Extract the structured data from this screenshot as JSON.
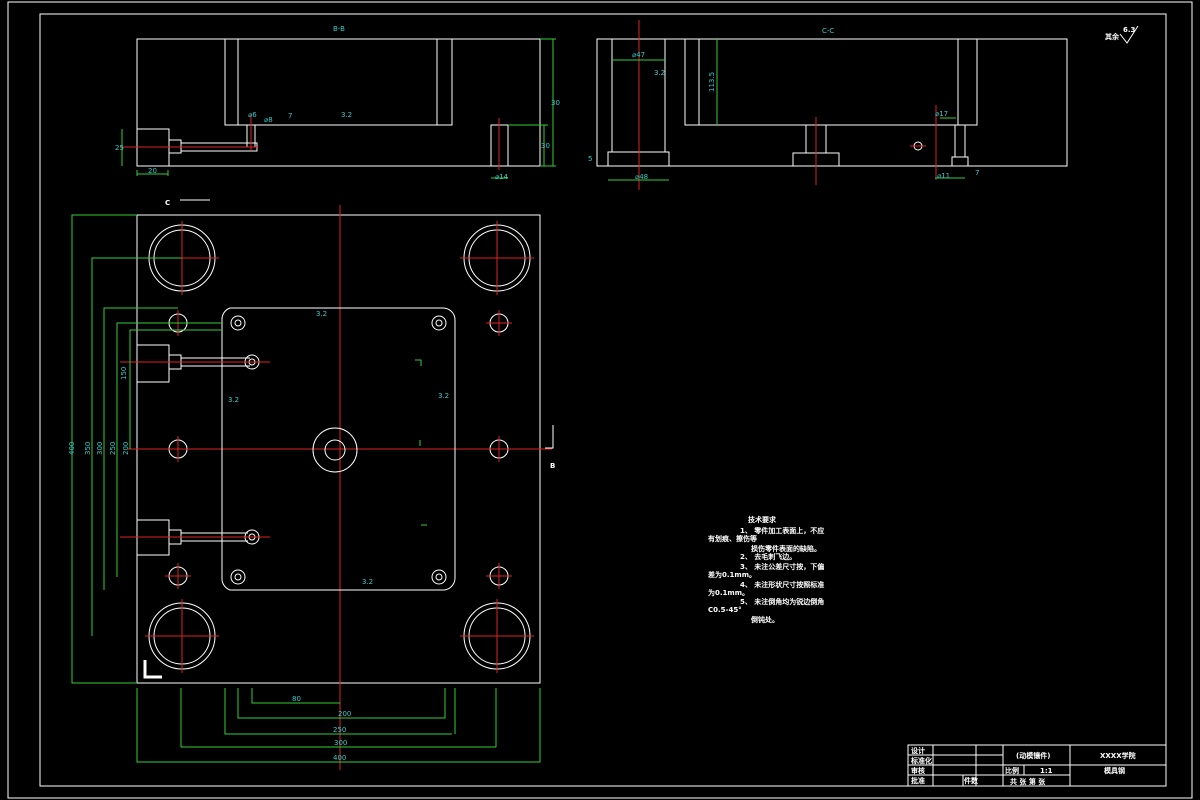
{
  "sections": {
    "bb_label": "B-B",
    "cc_label": "C-C",
    "view_c": "C",
    "view_b": "B"
  },
  "dims_bb": [
    "⌀6",
    "⌀8",
    "7",
    "3.2",
    "20",
    "30",
    "⌀14",
    "30",
    "25"
  ],
  "dims_cc": [
    "⌀47",
    "3.2",
    "⌀17",
    "⌀11",
    "⌀48",
    "5",
    "7",
    "113.5"
  ],
  "dims_bottom": [
    "80",
    "200",
    "250",
    "300",
    "350",
    "400"
  ],
  "dims_left": [
    "400",
    "350",
    "300",
    "250",
    "200",
    "150"
  ],
  "roughness": {
    "label": "其余",
    "value": "6.3"
  },
  "plan_roughness": [
    "3.2",
    "3.2",
    "3.2",
    "3.2"
  ],
  "tech_req": {
    "title": "技术要求",
    "lines": [
      "1、 零件加工表面上，不应",
      "有划痕、擦伤等",
      "损伤零件表面的缺陷。",
      "2、 去毛刺飞边。",
      "3、 未注公差尺寸按，下偏",
      "差为0.1mm。",
      "4、 未注形状尺寸按照标准",
      "为0.1mm。",
      "5、 未注倒角均为锐边倒角",
      "C0.5-45°",
      "倒钝处。"
    ]
  },
  "title_block": {
    "rows": [
      "设计",
      "标准化",
      "审核",
      "批准"
    ],
    "stage": "阶段",
    "part": "(动模镶件)",
    "school": "XXXX学院",
    "ratio_label": "比例",
    "ratio": "1:1",
    "material": "模具钢",
    "sheet": "共 张 第 张",
    "qty": "件数"
  },
  "colors": {
    "outline": "#ffffff",
    "dimension": "#33cc33",
    "center": "#dd2222",
    "text": "#33cccc",
    "hatch": "#e6e68a"
  }
}
